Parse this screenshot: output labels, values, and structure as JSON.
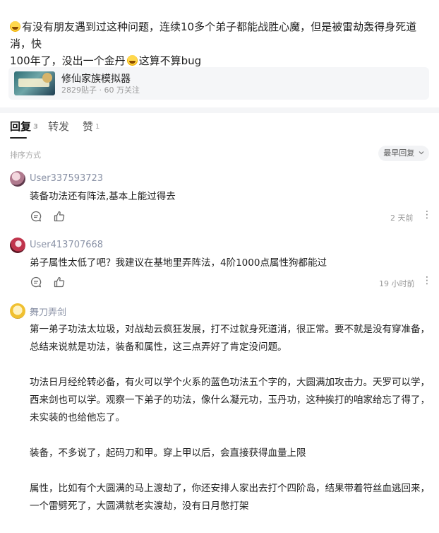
{
  "post": {
    "line1": "有没有朋友遇到过这种问题，连续10多个弟子都能战胜心魔，但是被雷劫轰得身死道消，快",
    "line2a": "100年了，没出一个金丹",
    "line2b": "这算不算bug"
  },
  "forum": {
    "name": "修仙家族模拟器",
    "stats": "2829贴子 · 60 万关注"
  },
  "tabs": [
    {
      "label": "回复",
      "count": "3"
    },
    {
      "label": "转发",
      "count": ""
    },
    {
      "label": "赞",
      "count": "1"
    }
  ],
  "sort": {
    "label": "排序方式",
    "button": "最早回复"
  },
  "comments": [
    {
      "user": "User337593723",
      "paragraphs": [
        "装备功法还有阵法,基本上能过得去"
      ],
      "time": "2 天前"
    },
    {
      "user": "User413707668",
      "paragraphs": [
        "弟子属性太低了吧？我建议在基地里弄阵法，4阶1000点属性狗都能过"
      ],
      "time": "19 小时前"
    },
    {
      "user": "舞刀弄剑",
      "paragraphs": [
        "第一弟子功法太垃圾，对战劫云疯狂发展，打不过就身死道消，很正常。要不就是没有穿准备，总结来说就是功法，装备和属性，这三点弄好了肯定没问题。",
        "功法日月经纶转必备，有火可以学个火系的蓝色功法五个字的，大圆满加攻击力。天罗可以学，西来剑也可以学。观察一下弟子的功法，像什么凝元功，玉丹功，这种挨打的咱家给忘了得了，未实装的也给他忘了。",
        "装备，不多说了，起码刀和甲。穿上甲以后，会直接获得血量上限",
        "属性，比如有个大圆满的马上渡劫了，你还安排人家出去打个四阶岛，结果带着符丝血逃回来，一个雷劈死了，大圆满就老实渡劫，没有日月憋打架"
      ],
      "time": ""
    }
  ],
  "icons": {
    "emoji": "grinning-sweat-emoji",
    "comment": "comment-icon",
    "like": "thumbs-up-icon",
    "more": "more-vertical-icon",
    "chevron": "chevron-down-icon"
  }
}
